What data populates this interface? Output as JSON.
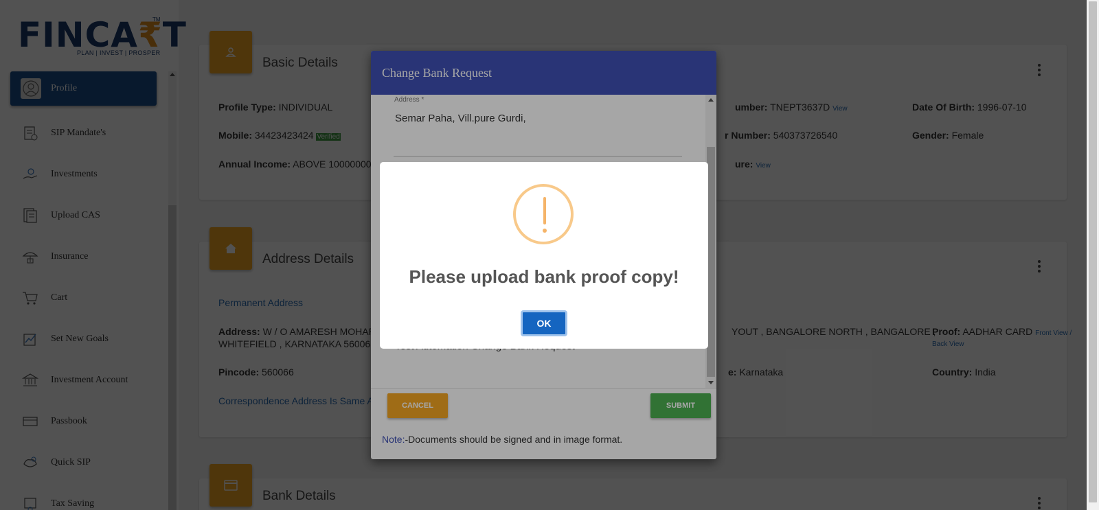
{
  "logo": {
    "text_pre": "FINCA",
    "text_rupee": "₹",
    "text_post": "T",
    "tm": "TM",
    "tagline": "PLAN | INVEST | PROSPER"
  },
  "sidebar": {
    "items": [
      {
        "label": "Profile",
        "icon": "user-icon",
        "active": true
      },
      {
        "label": "SIP Mandate's",
        "icon": "mandate-icon"
      },
      {
        "label": "Investments",
        "icon": "investments-icon"
      },
      {
        "label": "Upload CAS",
        "icon": "upload-cas-icon"
      },
      {
        "label": "Insurance",
        "icon": "insurance-icon"
      },
      {
        "label": "Cart",
        "icon": "cart-icon"
      },
      {
        "label": "Set New Goals",
        "icon": "goals-icon"
      },
      {
        "label": "Investment Account",
        "icon": "bank-icon"
      },
      {
        "label": "Passbook",
        "icon": "passbook-icon"
      },
      {
        "label": "Quick SIP",
        "icon": "quick-sip-icon"
      },
      {
        "label": "Tax Saving",
        "icon": "tax-saving-icon"
      }
    ]
  },
  "basic": {
    "title": "Basic Details",
    "profile_type_label": "Profile Type:",
    "profile_type": "INDIVIDUAL",
    "pan_label": "umber:",
    "pan": "TNEPT3637D",
    "pan_link": "View",
    "dob_label": "Date Of Birth:",
    "dob": "1996-07-10",
    "mobile_label": "Mobile:",
    "mobile": "34423423424",
    "verified": "Verified",
    "aadhar_label": "r Number:",
    "aadhar": "540373726540",
    "gender_label": "Gender:",
    "gender": "Female",
    "income_label": "Annual Income:",
    "income": "ABOVE 10000000",
    "signature_label": "ure:",
    "signature_link": "View"
  },
  "address": {
    "title": "Address Details",
    "permanent": "Permanent Address",
    "address_label": "Address:",
    "address_line1": "W / O AMARESH MOHAPA",
    "address_line2": "WHITEFIELD , KARNATAKA 560066",
    "address_right": "YOUT , BANGALORE NORTH , BANGALORE ,",
    "proof_label": "Proof:",
    "proof": "AADHAR CARD",
    "proof_link1": "Front View /",
    "proof_link2": "Back View",
    "pincode_label": "Pincode:",
    "pincode": "560066",
    "state_label": "e:",
    "state": "Karnataka",
    "country_label": "Country:",
    "country": "India",
    "corr": "Correspondence Address Is Same A"
  },
  "bank": {
    "title": "Bank Details"
  },
  "modal": {
    "title": "Change Bank Request",
    "address_label": "Address *",
    "address_value": "Semar Paha, Vill.pure Gurdi,",
    "remark_value": "Test Automation Change Bank Request",
    "cancel": "CANCEL",
    "submit": "SUBMIT",
    "note_label": "Note:",
    "note_text": "-Documents should be signed and in image format."
  },
  "alert": {
    "message": "Please upload bank proof copy!",
    "ok": "OK"
  },
  "colors": {
    "accent": "#f5a623",
    "primary": "#3f51b5",
    "brand": "#1b3a6b",
    "success": "#4caf50"
  }
}
